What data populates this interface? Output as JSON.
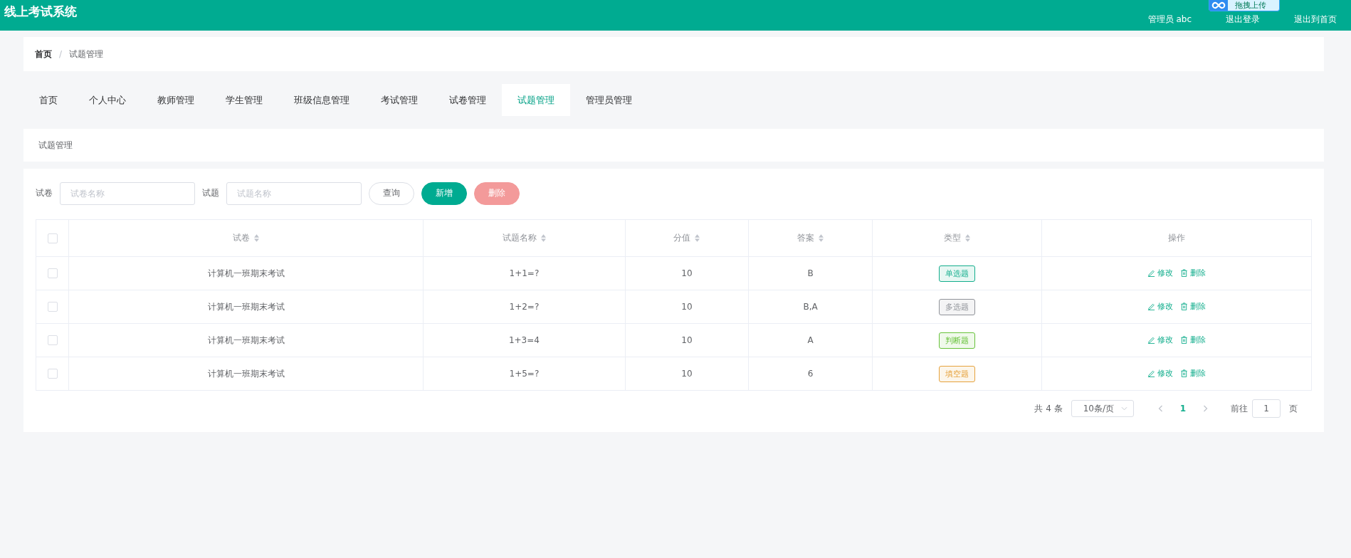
{
  "header": {
    "title": "线上考试系统",
    "links": [
      "管理员 abc",
      "退出登录",
      "退出到首页"
    ],
    "upload_widget": {
      "label": "拖拽上传"
    }
  },
  "breadcrumb_separator": "/",
  "breadcrumb": [
    {
      "label": "首页",
      "selected": false
    },
    {
      "label": "试题管理",
      "selected": true
    }
  ],
  "tabs": [
    {
      "label": "首页",
      "selected": false
    },
    {
      "label": "个人中心",
      "selected": false
    },
    {
      "label": "教师管理",
      "selected": false
    },
    {
      "label": "学生管理",
      "selected": false
    },
    {
      "label": "班级信息管理",
      "selected": false
    },
    {
      "label": "考试管理",
      "selected": false
    },
    {
      "label": "试卷管理",
      "selected": false
    },
    {
      "label": "试题管理",
      "selected": true
    },
    {
      "label": "管理员管理",
      "selected": false
    }
  ],
  "section_title": "试题管理",
  "filters": [
    {
      "label": "试卷",
      "placeholder": "试卷名称"
    },
    {
      "label": "试题",
      "placeholder": "试题名称"
    }
  ],
  "buttons": [
    {
      "label": "查询",
      "kind": "plain",
      "disabled": false
    },
    {
      "label": "新增",
      "kind": "primary",
      "disabled": false
    },
    {
      "label": "删除",
      "kind": "danger",
      "disabled": true
    }
  ],
  "table": {
    "select_all_checked": false,
    "columns": [
      {
        "label": "试卷",
        "sortable": true
      },
      {
        "label": "试题名称",
        "sortable": true
      },
      {
        "label": "分值",
        "sortable": true
      },
      {
        "label": "答案",
        "sortable": true
      },
      {
        "label": "类型",
        "sortable": true
      },
      {
        "label": "操作",
        "sortable": false
      }
    ],
    "rows": [
      {
        "checked": false,
        "paper": "计算机一班期末考试",
        "question": "1+1=?",
        "score": "10",
        "answer": "B",
        "type": {
          "label": "单选题",
          "color": "#13ae8d"
        },
        "actions": [
          "修改",
          "删除"
        ]
      },
      {
        "checked": false,
        "paper": "计算机一班期末考试",
        "question": "1+2=?",
        "score": "10",
        "answer": "B,A",
        "type": {
          "label": "多选题",
          "color": "#909399"
        },
        "actions": [
          "修改",
          "删除"
        ]
      },
      {
        "checked": false,
        "paper": "计算机一班期末考试",
        "question": "1+3=4",
        "score": "10",
        "answer": "A",
        "type": {
          "label": "判断题",
          "color": "#67c23a"
        },
        "actions": [
          "修改",
          "删除"
        ]
      },
      {
        "checked": false,
        "paper": "计算机一班期末考试",
        "question": "1+5=?",
        "score": "10",
        "answer": "6",
        "type": {
          "label": "填空题",
          "color": "#e6a23c"
        },
        "actions": [
          "修改",
          "删除"
        ]
      }
    ]
  },
  "pagination": {
    "total": "共 4 条",
    "page_size": "10条/页",
    "pages": [
      {
        "label": "1",
        "selected": true
      }
    ],
    "goto_label": "前往",
    "goto_value": "1",
    "goto_suffix": "页"
  }
}
